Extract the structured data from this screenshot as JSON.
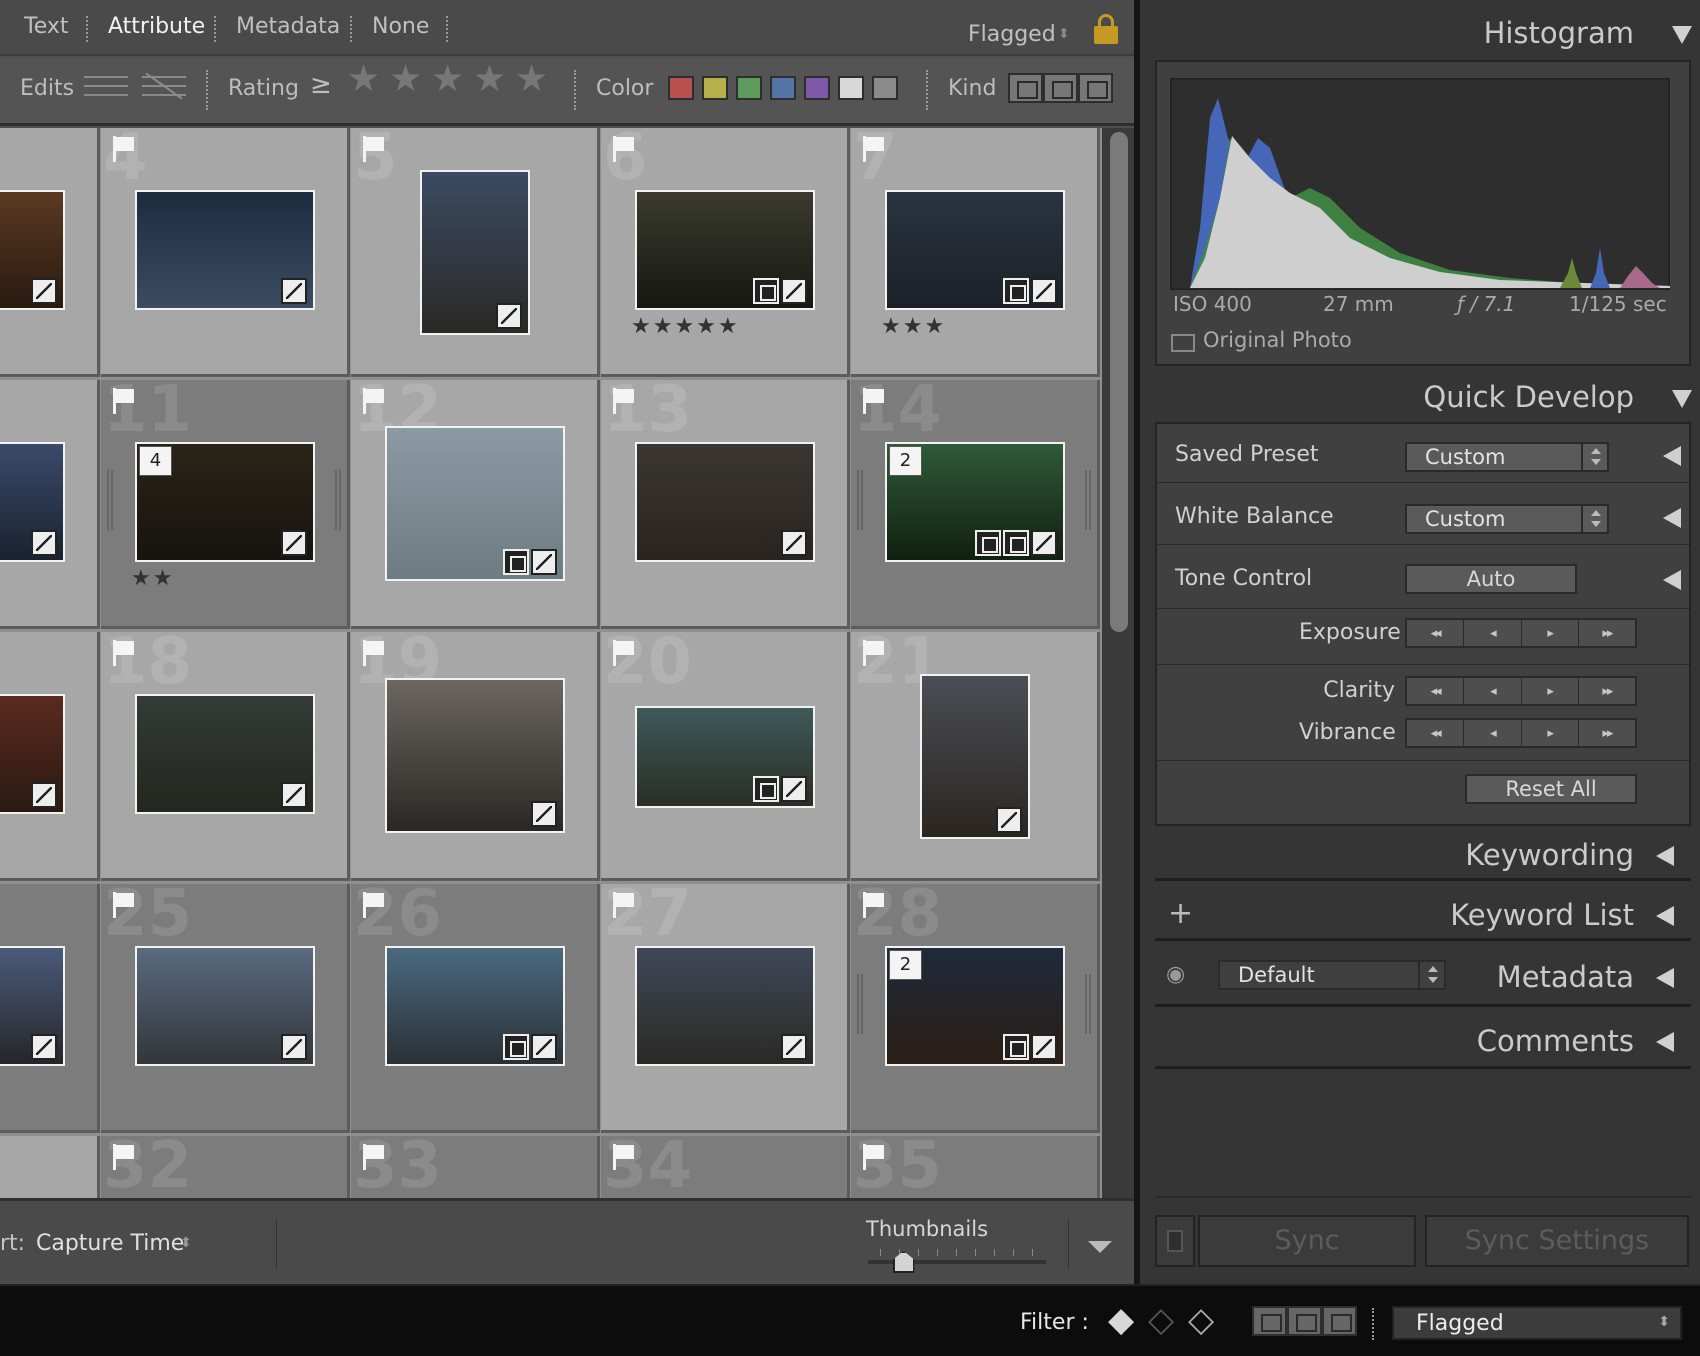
{
  "filter_bar": {
    "tabs": [
      "Text",
      "Attribute",
      "Metadata",
      "None"
    ],
    "active_tab": "Attribute",
    "preset_label": "Flagged",
    "edits_label": "Edits",
    "rating_label": "Rating",
    "rating_operator": "≥",
    "color_label": "Color",
    "kind_label": "Kind",
    "color_swatches": [
      "#b8504e",
      "#b5b04a",
      "#5d9a5b",
      "#5474a8",
      "#7e58a8",
      "#d8d8d8",
      "#8a8a8a"
    ]
  },
  "grid": {
    "cells": [
      {
        "num": "",
        "style": "light",
        "flag": false,
        "thumb_colors": [
          "#5a3a22",
          "#2a1a10"
        ],
        "rating": "",
        "stack": "",
        "badges": 1
      },
      {
        "num": "4",
        "style": "light",
        "flag": true,
        "thumb_colors": [
          "#1d2b3f",
          "#3c4c60"
        ],
        "rating": "",
        "stack": "",
        "badges": 1
      },
      {
        "num": "5",
        "style": "light",
        "flag": true,
        "thumb_colors": [
          "#3b4a63",
          "#2a2a25"
        ],
        "rating": "",
        "stack": "",
        "badges": 1
      },
      {
        "num": "6",
        "style": "light",
        "flag": true,
        "thumb_colors": [
          "#3a3a30",
          "#16180f"
        ],
        "rating": "★★★★★",
        "stack": "",
        "badges": 2
      },
      {
        "num": "7",
        "style": "light",
        "flag": true,
        "thumb_colors": [
          "#2a3340",
          "#1c2128"
        ],
        "rating": "★★★",
        "stack": "",
        "badges": 2
      },
      {
        "num": "",
        "style": "light",
        "flag": false,
        "thumb_colors": [
          "#3a4a6a",
          "#1a2230"
        ],
        "rating": "",
        "stack": "",
        "badges": 1
      },
      {
        "num": "11",
        "style": "dark",
        "flag": true,
        "thumb_colors": [
          "#2a2418",
          "#17140f"
        ],
        "rating": "★★",
        "stack": "4",
        "badges": 1
      },
      {
        "num": "12",
        "style": "light",
        "flag": true,
        "thumb_colors": [
          "#8c9aa3",
          "#6d7b83"
        ],
        "rating": "",
        "stack": "",
        "badges": 2
      },
      {
        "num": "13",
        "style": "light",
        "flag": true,
        "thumb_colors": [
          "#3a3632",
          "#2a2420"
        ],
        "rating": "",
        "stack": "",
        "badges": 1
      },
      {
        "num": "14",
        "style": "dark",
        "flag": true,
        "thumb_colors": [
          "#2f5a38",
          "#11200f"
        ],
        "rating": "",
        "stack": "2",
        "badges": 3
      },
      {
        "num": "",
        "style": "light",
        "flag": false,
        "thumb_colors": [
          "#5a2a1f",
          "#2a1a12"
        ],
        "rating": "",
        "stack": "",
        "badges": 1
      },
      {
        "num": "18",
        "style": "light",
        "flag": true,
        "thumb_colors": [
          "#343a35",
          "#22271f"
        ],
        "rating": "",
        "stack": "",
        "badges": 1
      },
      {
        "num": "19",
        "style": "light",
        "flag": true,
        "thumb_colors": [
          "#6b6660",
          "#2a2724"
        ],
        "rating": "",
        "stack": "",
        "badges": 1
      },
      {
        "num": "20",
        "style": "light",
        "flag": true,
        "thumb_colors": [
          "#3e5a5a",
          "#2a2e24"
        ],
        "rating": "",
        "stack": "",
        "badges": 2
      },
      {
        "num": "21",
        "style": "light",
        "flag": true,
        "thumb_colors": [
          "#4a4e55",
          "#2b2520"
        ],
        "rating": "",
        "stack": "",
        "badges": 1
      },
      {
        "num": "",
        "style": "dark",
        "flag": false,
        "thumb_colors": [
          "#4a5a7a",
          "#26262a"
        ],
        "rating": "",
        "stack": "",
        "badges": 1
      },
      {
        "num": "25",
        "style": "dark",
        "flag": true,
        "thumb_colors": [
          "#5a6a80",
          "#33363a"
        ],
        "rating": "",
        "stack": "",
        "badges": 1
      },
      {
        "num": "26",
        "style": "dark",
        "flag": true,
        "thumb_colors": [
          "#4a6a80",
          "#2a3036"
        ],
        "rating": "",
        "stack": "",
        "badges": 2
      },
      {
        "num": "27",
        "style": "light",
        "flag": true,
        "thumb_colors": [
          "#3f4858",
          "#2a2a25"
        ],
        "rating": "",
        "stack": "",
        "badges": 1
      },
      {
        "num": "28",
        "style": "dark",
        "flag": true,
        "thumb_colors": [
          "#1f2a3a",
          "#2a1e15"
        ],
        "rating": "",
        "stack": "2",
        "badges": 2
      },
      {
        "num": "",
        "style": "light",
        "flag": false,
        "thumb_colors": [],
        "rating": "",
        "stack": "",
        "badges": 0
      },
      {
        "num": "32",
        "style": "dark",
        "flag": true,
        "thumb_colors": [],
        "rating": "",
        "stack": "",
        "badges": 0
      },
      {
        "num": "33",
        "style": "dark",
        "flag": true,
        "thumb_colors": [],
        "rating": "",
        "stack": "",
        "badges": 0
      },
      {
        "num": "34",
        "style": "dark",
        "flag": true,
        "thumb_colors": [],
        "rating": "",
        "stack": "",
        "badges": 0
      },
      {
        "num": "35",
        "style": "dark",
        "flag": true,
        "thumb_colors": [],
        "rating": "",
        "stack": "",
        "badges": 0
      }
    ]
  },
  "toolbar": {
    "sort_prefix": "rt:",
    "sort_value": "Capture Time",
    "thumbnails_label": "Thumbnails",
    "thumbnail_size": 0.2
  },
  "histogram": {
    "title": "Histogram",
    "iso": "ISO 400",
    "focal": "27 mm",
    "aperture": "ƒ / 7.1",
    "shutter": "1/125 sec",
    "original_photo": "Original Photo"
  },
  "quick_develop": {
    "title": "Quick Develop",
    "saved_preset_label": "Saved Preset",
    "saved_preset_value": "Custom",
    "white_balance_label": "White Balance",
    "white_balance_value": "Custom",
    "tone_control_label": "Tone Control",
    "auto_label": "Auto",
    "exposure_label": "Exposure",
    "clarity_label": "Clarity",
    "vibrance_label": "Vibrance",
    "reset_label": "Reset All",
    "stepper_glyphs": [
      "◂◂",
      "◂",
      "▸",
      "▸▸"
    ]
  },
  "panels": {
    "keywording": "Keywording",
    "keyword_list": "Keyword List",
    "metadata": "Metadata",
    "metadata_preset": "Default",
    "comments": "Comments",
    "plus": "+",
    "sync": "Sync",
    "sync_settings": "Sync Settings"
  },
  "status_bar": {
    "filter_label": "Filter :",
    "filter_value": "Flagged"
  }
}
